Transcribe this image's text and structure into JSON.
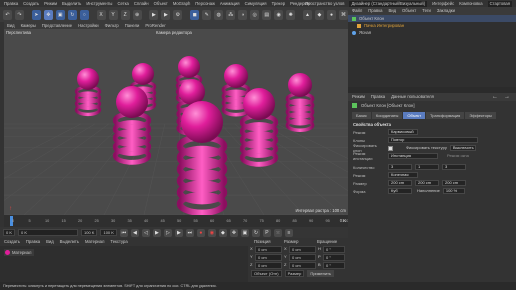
{
  "menubar": {
    "items": [
      "Правка",
      "Создать",
      "Режим",
      "Выделить",
      "Инструменты",
      "Сетка",
      "Сплайн",
      "Объект",
      "MoGraph",
      "Персонаж",
      "Анимация",
      "Симуляция",
      "Трекер",
      "Рендеринг"
    ],
    "right": [
      "Пространство узлов",
      "Дизайнер (Стандартный/Визуальный)",
      "Интерфейс",
      "Компоновка",
      "Стартовая"
    ]
  },
  "viewport": {
    "menu": [
      "Вид",
      "Камеры",
      "Представление",
      "Настройки",
      "Фильтр",
      "Панели",
      "ProRender"
    ],
    "title": "Перспектива",
    "camera": "Камера редактора",
    "grid": "Интервал растра : 100 cm"
  },
  "timeline": {
    "ticks": [
      "0",
      "5",
      "10",
      "15",
      "20",
      "25",
      "30",
      "35",
      "40",
      "45",
      "50",
      "55",
      "60",
      "65",
      "70",
      "75",
      "80",
      "85",
      "90",
      "95",
      "100"
    ],
    "current": "0 K"
  },
  "transport": {
    "start": "0 K",
    "start2": "0 K",
    "end": "100 K",
    "end2": "100 K"
  },
  "material": {
    "menu": [
      "Создать",
      "Правка",
      "Вид",
      "Выделить",
      "Материал",
      "Текстура"
    ],
    "name": "Материал"
  },
  "coords": {
    "headers": [
      "Позиция",
      "Размер",
      "Вращение"
    ],
    "rows": [
      {
        "axis": "X",
        "pos": "0 cm",
        "size": "0 cm",
        "rot": "H",
        "rv": "0 °"
      },
      {
        "axis": "Y",
        "pos": "0 cm",
        "size": "0 cm",
        "rot": "P",
        "rv": "0 °"
      },
      {
        "axis": "Z",
        "pos": "0 cm",
        "size": "0 cm",
        "rot": "B",
        "rv": "0 °"
      }
    ],
    "mode": "Объект (Отн)",
    "mode2": "Размер",
    "apply": "Применить"
  },
  "objects": {
    "menu": [
      "Файл",
      "Правка",
      "Вид",
      "Объект",
      "Теги",
      "Закладки"
    ],
    "items": [
      "Объект Клон",
      "Пачка Интегрирован",
      "Ясная"
    ]
  },
  "attributes": {
    "menu": [
      "Режим",
      "Правка",
      "Данные пользователя"
    ],
    "title": "Объект Клон [Объект Клон]",
    "tabs": [
      "Базис",
      "Координаты",
      "Объект",
      "Трансформация",
      "Эффекторы"
    ],
    "section": "Свойства объекта",
    "mode_label": "Режим",
    "mode_value": "Карвисовый",
    "clones_label": "Клоны",
    "clones_value": "Повтор",
    "fix_label": "Фиксировать клон",
    "fix_tex": "Фиксировать текстуру",
    "fix_tex_val": "Выключить",
    "instance_label": "Режим инстанции",
    "instance_value": "Инстанция",
    "render_label": "Режим окна",
    "count_label": "Количество",
    "count_values": [
      "3",
      "1",
      "3"
    ],
    "mode2_label": "Режим",
    "mode2_value": "Конечная",
    "size_label": "Размер",
    "size_values": [
      "200 cm",
      "200 cm",
      "200 cm"
    ],
    "shape_label": "Форма",
    "shape_value": "Куб",
    "fill_label": "Наполнение",
    "fill_value": "100 %"
  },
  "status": {
    "text": "Переместить: кликнуть и перетащить для перемещения элементов. SHIFT для ограничения по оси. CTRL для удаления."
  },
  "colors": {
    "accent": "#5a7cc0",
    "object": "#e01e9b",
    "viewport": "#4a4a4a"
  }
}
